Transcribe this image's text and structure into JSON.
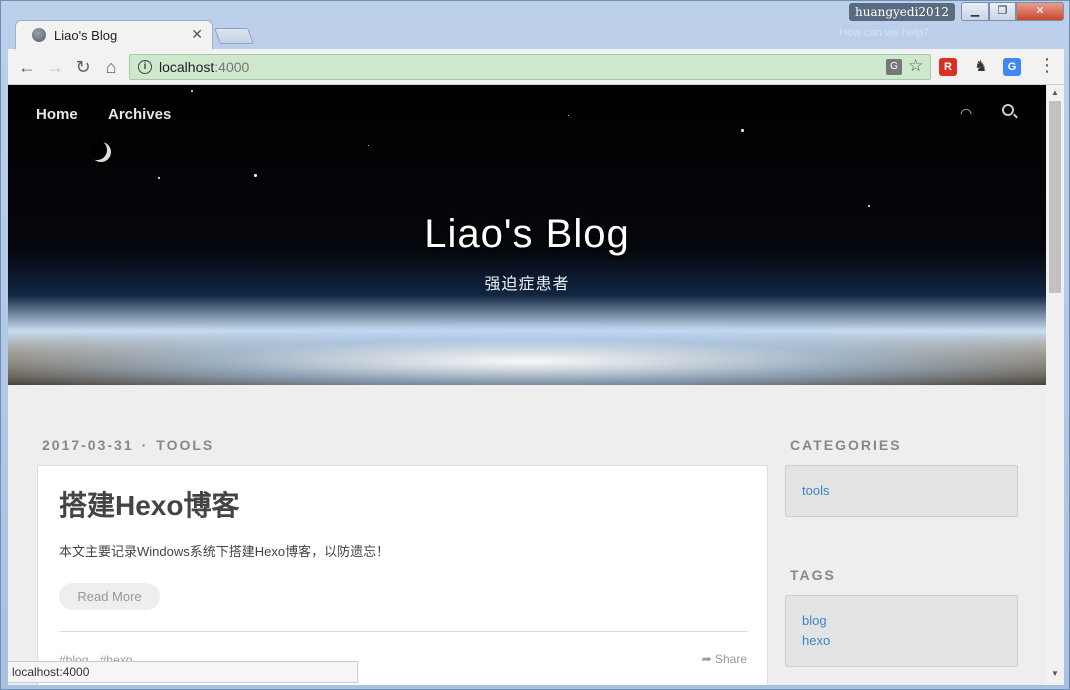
{
  "window": {
    "user_badge": "huangyedi2012",
    "ghost_text": "How can we help?",
    "min_glyph": "▁",
    "max_glyph": "❐",
    "close_glyph": "✕"
  },
  "tab": {
    "title": "Liao's Blog",
    "close_glyph": "✕"
  },
  "toolbar": {
    "back_glyph": "←",
    "forward_glyph": "→",
    "reload_glyph": "↻",
    "home_glyph": "⌂",
    "url_host": "localhost",
    "url_port": ":4000",
    "info_glyph": "i",
    "translate_glyph": "G",
    "star_glyph": "☆",
    "ext_glyph_1": "R",
    "ext_glyph_2": "♞",
    "ext_glyph_3": "G",
    "menu_glyph": "⋮"
  },
  "site": {
    "nav": {
      "home": "Home",
      "archives": "Archives"
    },
    "rss_glyph": "◠",
    "title": "Liao's Blog",
    "subtitle": "强迫症患者"
  },
  "post": {
    "date": "2017-03-31",
    "meta_sep": "·",
    "category": "TOOLS",
    "title": "搭建Hexo博客",
    "excerpt": "本文主要记录Windows系统下搭建Hexo博客，以防遗忘！",
    "read_more": "Read More",
    "tags": [
      "#blog",
      "#hexo"
    ],
    "share_glyph": "➦",
    "share": "Share"
  },
  "sidebar": {
    "categories_heading": "CATEGORIES",
    "categories": [
      "tools"
    ],
    "tags_heading": "TAGS",
    "tags": [
      "blog",
      "hexo"
    ]
  },
  "scrollbar": {
    "up_glyph": "▲",
    "down_glyph": "▼"
  },
  "status_bar": "localhost:4000",
  "colors": {
    "link": "#3d86c6",
    "omnibox_secure": "#cde8cd"
  }
}
